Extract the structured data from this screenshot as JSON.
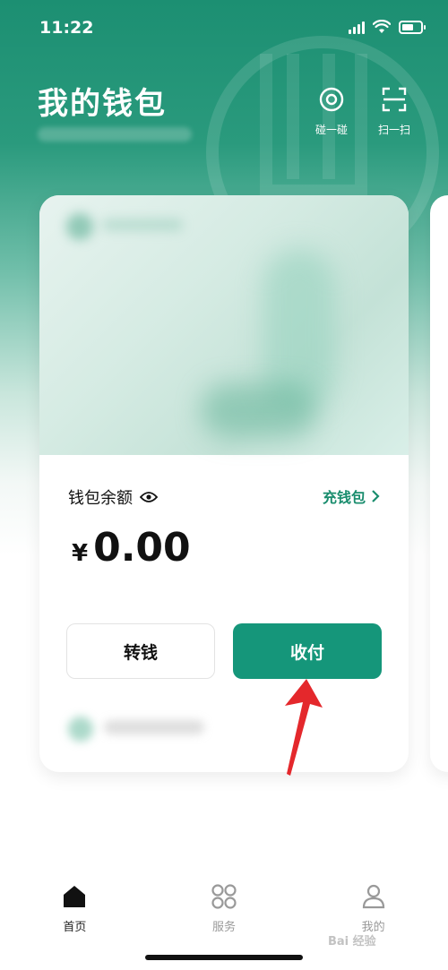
{
  "status_bar": {
    "time": "11:22"
  },
  "header": {
    "title": "我的钱包",
    "actions": [
      {
        "label": "碰一碰",
        "icon": "nfc-touch-icon"
      },
      {
        "label": "扫一扫",
        "icon": "scan-icon"
      }
    ]
  },
  "wallet_card": {
    "balance_label": "钱包余额",
    "topup_label": "充钱包",
    "currency_symbol": "¥",
    "balance": "0.00",
    "transfer_label": "转钱",
    "pay_label": "收付"
  },
  "tab_bar": {
    "items": [
      {
        "label": "首页",
        "icon": "home-icon",
        "active": true
      },
      {
        "label": "服务",
        "icon": "services-grid-icon",
        "active": false
      },
      {
        "label": "我的",
        "icon": "profile-icon",
        "active": false
      }
    ]
  },
  "colors": {
    "brand": "#15967a",
    "link": "#1a8d6e"
  },
  "watermark": "Bai 经验"
}
